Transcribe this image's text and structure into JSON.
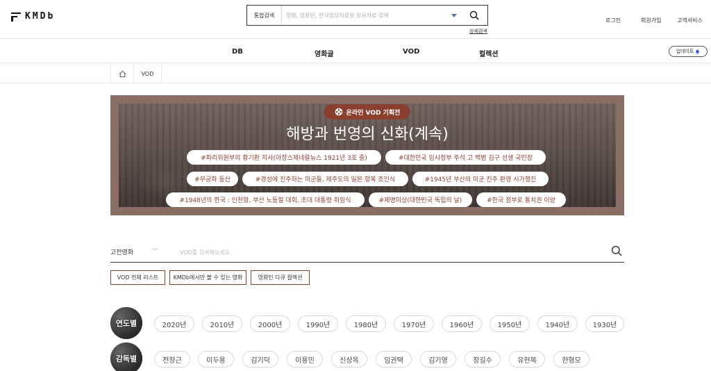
{
  "header": {
    "logo_text": "KMDb",
    "search_scope": "통합검색",
    "search_placeholder": "영화, 영화인, 한국영상자료원 보유자료 검색",
    "advanced_search": "상세검색",
    "login": "로그인",
    "signup": "회원가입",
    "support": "고객서비스"
  },
  "nav": {
    "items": [
      "DB",
      "영화글",
      "VOD",
      "컬렉션"
    ],
    "update_button": "업데이트"
  },
  "breadcrumb": {
    "current": "VOD"
  },
  "banner": {
    "badge": "온라인 VOD 기획전",
    "title": "해방과 번영의 신화(계속)",
    "tags": [
      "#파리위원부의 황기환 지사(아장스제네랄뉴스 1921년 3호 중)",
      "#대한민국 임시정부 주석 고 백범 김구 선생 국민장",
      "#무궁화 동산",
      "#경성에 진주하는 미군들, 제주도의 일본 항복 조인식",
      "#1945년 부산의 미군 진주 환영 시가행진",
      "#1948년의 한국 : 인천항, 부산 노동절 대회, 초대 대통령 취임식",
      "#제명미상(대한민국 독립의 날)",
      "#한국 정부로 통치권 이양"
    ]
  },
  "vod_search": {
    "category": "고전영화",
    "placeholder": "VOD를 검색해보세요"
  },
  "quick_buttons": [
    "VOD 전체 리스트",
    "KMDb에서만 볼 수 있는 영화",
    "영화인 다큐 컬렉션"
  ],
  "filters": {
    "decade_label": "연도별",
    "decades": [
      "2020년",
      "2010년",
      "2000년",
      "1990년",
      "1980년",
      "1970년",
      "1960년",
      "1950년",
      "1940년",
      "1930년"
    ],
    "director_label": "감독별",
    "directors": [
      "전창근",
      "이두용",
      "김기덕",
      "이용민",
      "신상옥",
      "임권택",
      "김기영",
      "장길수",
      "유현목",
      "한형모"
    ]
  },
  "colors": {
    "accent": "#8a3f2f",
    "banner_bg": "#8a6e66"
  }
}
